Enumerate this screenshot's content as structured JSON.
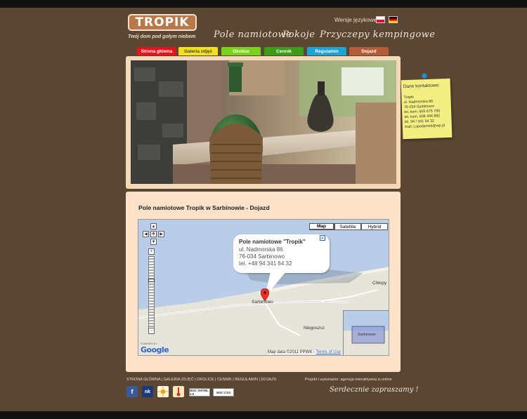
{
  "header": {
    "logo_text": "TROPIK",
    "tagline": "Twój dom pod gołym niebem",
    "lang_label": "Wersje językowe:"
  },
  "script_nav": [
    "Pole namiotowe",
    "Pokoje",
    "Przyczepy kempingowe"
  ],
  "tabs": [
    {
      "label": "Strona główna",
      "color": "#e8121f"
    },
    {
      "label": "Galeria zdjęć",
      "color": "#f2e21d"
    },
    {
      "label": "Okolice",
      "color": "#7bd21e"
    },
    {
      "label": "Cennik",
      "color": "#3f9c19"
    },
    {
      "label": "Regulamin",
      "color": "#1ba5d6"
    },
    {
      "label": "Dojazd",
      "color": "#b45b3a"
    }
  ],
  "contact_note": {
    "title": "Dane kontaktowe:",
    "lines": [
      "Tropik",
      "ul. Nadmorska 86",
      "76-034 Sarbinowo",
      "tel. kom.  605 675 790",
      "tel. kom.  606 446 882",
      "tel.  94 / 341 64 32",
      "mail: j.spodymek@wp.pl"
    ]
  },
  "page_title": "Pole namiotowe Tropik w Sarbinowie - Dojazd",
  "map": {
    "buttons": [
      "Map",
      "Satellite",
      "Hybrid"
    ],
    "bubble": {
      "title": "Pole namiotowe \"Tropik\"",
      "lines": [
        "ul. Nadmorska 86",
        "76-034 Sarbinowo",
        "tel. +48 94 341 64 32"
      ]
    },
    "labels": {
      "sarbinowo": "Sarbinowo",
      "chlopy": "Chłopy",
      "niegoszcz": "Niegoszcz",
      "overview_town": "Sarbinowo",
      "ski": "ski"
    },
    "google_powered": "POWERED BY",
    "google_word": "Google",
    "data_text": "Map data ©2011 PPWK - ",
    "terms": "Terms of Use"
  },
  "footer": {
    "nav": "STRONA GŁÓWNA | GALERIA ZDJĘĆ | OKOLICE | CENNIK | REGULAMIN | DOJAZD",
    "credits": "Projekt i wykonanie: agencja interaktywna ic.online",
    "welcome": "Serdecznie zapraszamy !",
    "icons": {
      "facebook": "f",
      "nk": "nk"
    },
    "badges": [
      "W3C XHTML 1.0",
      "W3C CSS"
    ]
  }
}
